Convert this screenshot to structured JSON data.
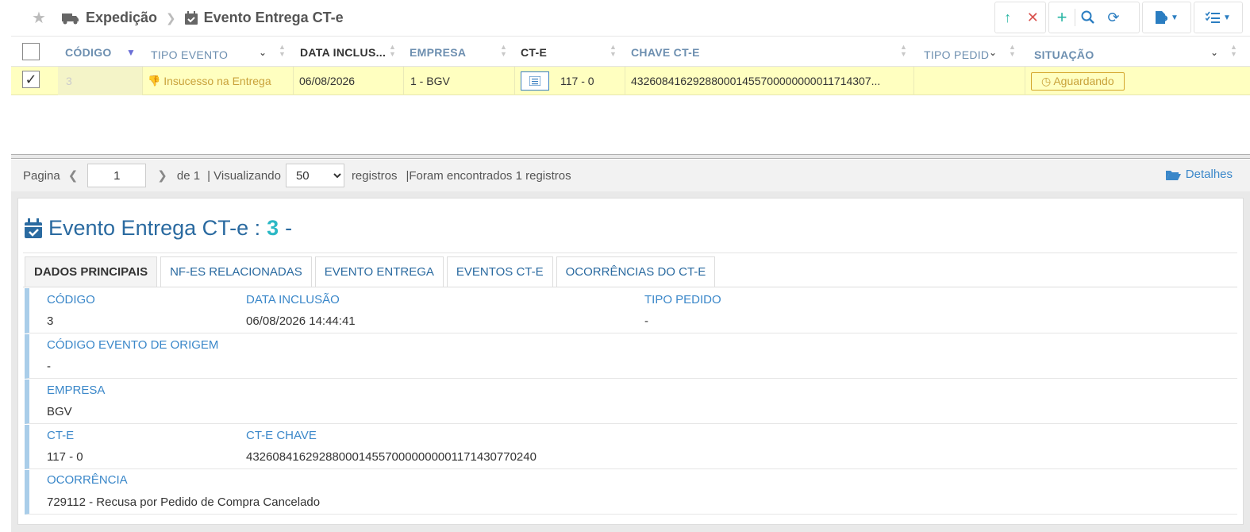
{
  "breadcrumb": {
    "module": "Expedição",
    "page": "Evento Entrega CT-e"
  },
  "toolbar": {
    "colors": {
      "green": "#26b5a3",
      "red": "#d9534f",
      "blue": "#2a7dc1"
    }
  },
  "grid": {
    "columns": [
      "CÓDIGO",
      "TIPO EVENTO",
      "DATA INCLUS...",
      "EMPRESA",
      "CT-E",
      "CHAVE CT-E",
      "TIPO PEDID",
      "SITUAÇÃO"
    ],
    "rows": [
      {
        "codigo": "3",
        "tipo_evento": "Insucesso na Entrega",
        "data_inclusao": "06/08/2026",
        "empresa": "1 - BGV",
        "cte": "117 - 0",
        "chave_cte": "43260841629288000145570000000001171430​7...",
        "tipo_pedido": "",
        "situacao": "Aguardando"
      }
    ]
  },
  "pager": {
    "pagina_label": "Pagina",
    "page_value": "1",
    "de_label": "de 1",
    "visualizando_label": "| Visualizando",
    "per_page": "50",
    "registros_label": "registros",
    "found_label": "|Foram encontrados 1 registros",
    "details_label": "Detalhes"
  },
  "detail": {
    "title": "Evento Entrega CT-e :",
    "number": "3",
    "suffix": "-",
    "tabs": [
      "DADOS PRINCIPAIS",
      "NF-ES RELACIONADAS",
      "EVENTO ENTREGA",
      "EVENTOS CT-E",
      "OCORRÊNCIAS DO CT-E"
    ],
    "fields": {
      "codigo_label": "CÓDIGO",
      "codigo": "3",
      "data_inclusao_label": "DATA INCLUSÃO",
      "data_inclusao": "06/08/2026 14:44:41",
      "tipo_pedido_label": "TIPO PEDIDO",
      "tipo_pedido": "-",
      "codigo_origem_label": "CÓDIGO EVENTO DE ORIGEM",
      "codigo_origem": "-",
      "empresa_label": "EMPRESA",
      "empresa": "BGV",
      "cte_label": "CT-E",
      "cte": "117 - 0",
      "cte_chave_label": "CT-E CHAVE",
      "cte_chave": "43260841629288000145570000000001171430770240",
      "ocorrencia_label": "OCORRÊNCIA",
      "ocorrencia": "729112 - Recusa por Pedido de Compra Cancelado"
    }
  }
}
